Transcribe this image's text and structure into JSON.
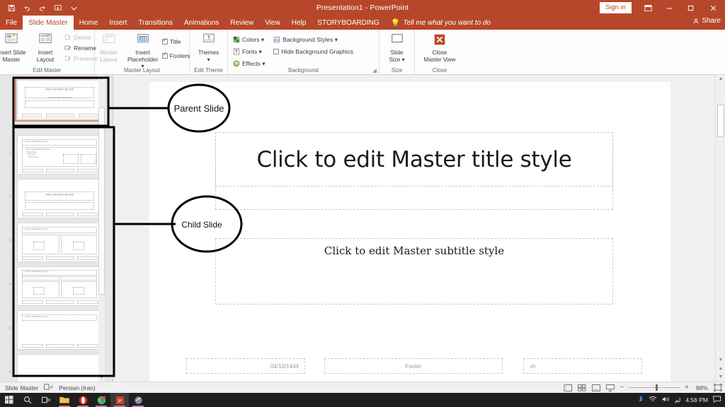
{
  "titlebar": {
    "document_title": "Presentation1  -  PowerPoint",
    "quick_access": [
      {
        "name": "save-icon",
        "label": "Save"
      },
      {
        "name": "undo-icon",
        "label": "Undo"
      },
      {
        "name": "redo-icon",
        "label": "Redo"
      },
      {
        "name": "start-slideshow-icon",
        "label": "Start From Beginning"
      },
      {
        "name": "customize-qat-icon",
        "label": "Customize Quick Access Toolbar"
      }
    ],
    "sign_in": "Sign in",
    "ribbon_display_options": "Ribbon Display Options",
    "minimize": "Minimize",
    "restore": "Restore Down",
    "close": "Close"
  },
  "tabs": [
    {
      "label": "File",
      "active": false
    },
    {
      "label": "Slide Master",
      "active": true
    },
    {
      "label": "Home",
      "active": false
    },
    {
      "label": "Insert",
      "active": false
    },
    {
      "label": "Transitions",
      "active": false
    },
    {
      "label": "Animations",
      "active": false
    },
    {
      "label": "Review",
      "active": false
    },
    {
      "label": "View",
      "active": false
    },
    {
      "label": "Help",
      "active": false
    },
    {
      "label": "STORYBOARDING",
      "active": false
    }
  ],
  "tellme": {
    "placeholder": "Tell me what you want to do",
    "icon": "lightbulb-icon"
  },
  "share": {
    "label": "Share",
    "icon": "share-person-icon"
  },
  "ribbon": {
    "groups": [
      {
        "name": "Edit Master",
        "label": "Edit Master",
        "big_buttons": [
          {
            "label": "Insert Slide\nMaster",
            "line1": "Insert Slide",
            "line2": "Master",
            "icon": "insert-slide-master-icon",
            "disabled": false
          },
          {
            "label": "Insert\nLayout",
            "line1": "Insert",
            "line2": "Layout",
            "icon": "insert-layout-icon",
            "disabled": false
          }
        ],
        "small_buttons": [
          {
            "label": "Delete",
            "icon": "delete-icon",
            "disabled": true
          },
          {
            "label": "Rename",
            "icon": "rename-icon",
            "disabled": false
          },
          {
            "label": "Preserve",
            "icon": "preserve-icon",
            "disabled": true
          }
        ]
      },
      {
        "name": "Master Layout",
        "label": "Master Layout",
        "big_buttons": [
          {
            "line1": "Master",
            "line2": "Layout",
            "icon": "master-layout-icon",
            "disabled": true
          },
          {
            "line1": "Insert",
            "line2": "Placeholder ▾",
            "icon": "insert-placeholder-icon",
            "disabled": false
          }
        ],
        "checkboxes": [
          {
            "label": "Title",
            "checked": true
          },
          {
            "label": "Footers",
            "checked": true
          }
        ]
      },
      {
        "name": "Edit Theme",
        "label": "Edit Theme",
        "big_buttons": [
          {
            "line1": "Themes",
            "line2": "▾",
            "icon": "themes-icon",
            "disabled": false
          }
        ]
      },
      {
        "name": "Background",
        "label": "Background",
        "small_buttons": [
          {
            "label": "Colors ▾",
            "icon": "colors-icon",
            "disabled": false
          },
          {
            "label": "Fonts ▾",
            "icon": "fonts-icon",
            "disabled": false
          },
          {
            "label": "Effects ▾",
            "icon": "effects-icon",
            "disabled": false
          }
        ],
        "small_buttons2": [
          {
            "label": "Background Styles ▾",
            "icon": "background-styles-icon",
            "disabled": false
          },
          {
            "label": "Hide Background Graphics",
            "checkbox": true,
            "checked": false
          }
        ],
        "dialog_launcher": "Format Background"
      },
      {
        "name": "Size",
        "label": "Size",
        "big_buttons": [
          {
            "line1": "Slide",
            "line2": "Size ▾",
            "icon": "slide-size-icon",
            "disabled": false
          }
        ]
      },
      {
        "name": "Close",
        "label": "Close",
        "big_buttons": [
          {
            "line1": "Close",
            "line2": "Master View",
            "icon": "close-master-view-icon",
            "disabled": false
          }
        ]
      }
    ]
  },
  "thumbnails": {
    "panel_name": "slide-master-thumbnail-panel",
    "items": [
      {
        "index": "",
        "kind": "master",
        "selected": true,
        "title": "Click to edit Master title style",
        "sub": "Click to edit Master subtitle style"
      },
      {
        "index": "1",
        "kind": "title-and-content",
        "selected": false,
        "title": "Click to edit Master title style"
      },
      {
        "index": "2",
        "kind": "title-slide",
        "selected": false,
        "title": "Click to edit Master title style"
      },
      {
        "index": "3",
        "kind": "two-content",
        "selected": false,
        "title": "Click to edit Master title style"
      },
      {
        "index": "4",
        "kind": "comparison",
        "selected": false,
        "title": "Click to edit Master title style"
      },
      {
        "index": "5",
        "kind": "title-only",
        "selected": false,
        "title": "Click to edit Master title style"
      },
      {
        "index": "6",
        "kind": "blank",
        "selected": false,
        "title": ""
      }
    ]
  },
  "annotations": [
    {
      "name": "parent-slide-callout",
      "label": "Parent Slide"
    },
    {
      "name": "child-slide-callout",
      "label": "Child Slide"
    }
  ],
  "slide": {
    "title_placeholder": "Click to edit Master title style",
    "subtitle_placeholder": "Click to edit Master subtitle style",
    "date_placeholder": "04/10/1444",
    "footer_placeholder": "Footer",
    "slide_number_placeholder": "‹#›"
  },
  "statusbar": {
    "view_name": "Slide Master",
    "language": "Persian (Iran)",
    "accessibility_icon": "accessibility-checker-icon",
    "views": [
      {
        "name": "normal-view-button",
        "glyph": "▤"
      },
      {
        "name": "slide-sorter-view-button",
        "glyph": "▦"
      },
      {
        "name": "reading-view-button",
        "glyph": "▥"
      },
      {
        "name": "slide-show-button",
        "glyph": "▽"
      }
    ],
    "zoom_out": "−",
    "zoom_in": "+",
    "zoom_level": "88%",
    "fit_slide": "Fit slide to current window"
  },
  "taskbar": {
    "items": [
      {
        "name": "start-button",
        "glyph": "⊞"
      },
      {
        "name": "search-button",
        "glyph": "○"
      },
      {
        "name": "task-view-button",
        "glyph": "❏"
      },
      {
        "name": "file-explorer-button",
        "glyph": "📁",
        "running": true
      },
      {
        "name": "opera-button",
        "glyph": "O",
        "running": true
      },
      {
        "name": "chrome-button",
        "glyph": "◉",
        "running": true
      },
      {
        "name": "powerpoint-button",
        "glyph": "P",
        "running": true,
        "active": true
      },
      {
        "name": "paint-button",
        "glyph": "✎",
        "running": true
      }
    ],
    "tray": {
      "bluetooth": "bluetooth-icon",
      "wifi": "wifi-icon",
      "volume": "volume-icon",
      "keyboard_layout": "لم",
      "time": "4:56 PM",
      "notifications": "notification-center-icon"
    }
  },
  "colors": {
    "accent": "#b7472a",
    "selected_thumb_outline": "#e08b6e",
    "ribbon_bg": "#fdfdfd",
    "workspace_bg": "#f0f0f0",
    "taskbar_bg": "#1f1f1f"
  }
}
